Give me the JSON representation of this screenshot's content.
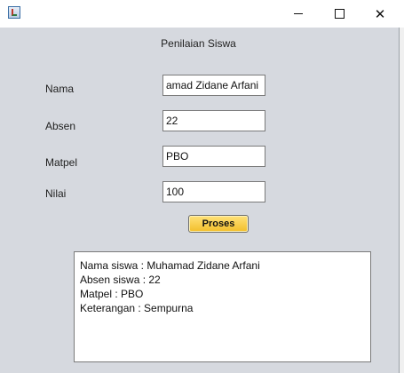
{
  "window": {
    "controls": {
      "minimize": "minimize-icon",
      "maximize": "maximize-icon",
      "close": "close-icon"
    }
  },
  "form": {
    "heading": "Penilaian Siswa",
    "fields": [
      {
        "label": "Nama",
        "value": "amad Zidane Arfani"
      },
      {
        "label": "Absen",
        "value": "22"
      },
      {
        "label": "Matpel",
        "value": "PBO"
      },
      {
        "label": "Nilai",
        "value": "100"
      }
    ],
    "button_label": "Proses"
  },
  "output": {
    "lines": [
      "Nama siswa : Muhamad Zidane Arfani",
      "Absen siswa : 22",
      "Matpel : PBO",
      "Keterangan : Sempurna"
    ]
  },
  "colors": {
    "window_bg": "#d6d9df",
    "button_bg": "#f2be2a"
  }
}
